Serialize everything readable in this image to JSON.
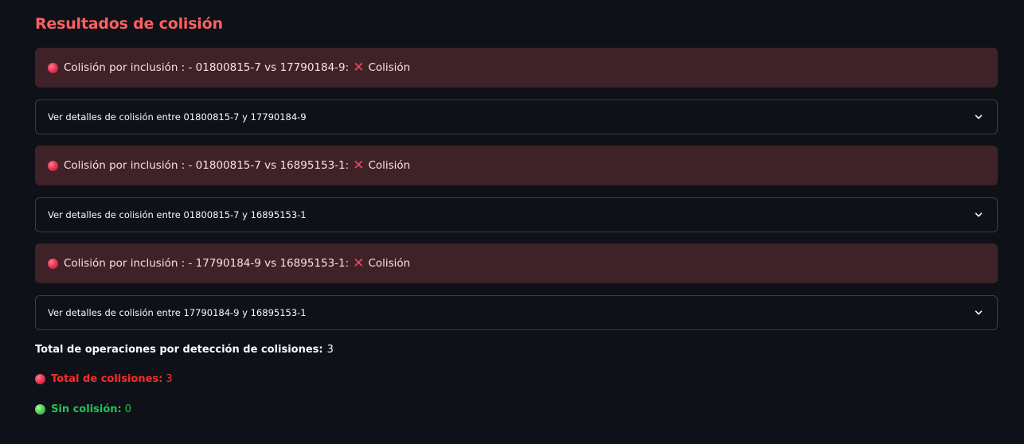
{
  "title": "Resultados de colisión",
  "results": [
    {
      "alert_text": "Colisión por inclusión : - 01800815-7 vs 17790184-9:",
      "status": "Colisión",
      "expander_label": "Ver detalles de colisión entre 01800815-7 y 17790184-9"
    },
    {
      "alert_text": "Colisión por inclusión : - 01800815-7 vs 16895153-1:",
      "status": "Colisión",
      "expander_label": "Ver detalles de colisión entre 01800815-7 y 16895153-1"
    },
    {
      "alert_text": "Colisión por inclusión : - 17790184-9 vs 16895153-1:",
      "status": "Colisión",
      "expander_label": "Ver detalles de colisión entre 17790184-9 y 16895153-1"
    }
  ],
  "summary": {
    "total_ops_label": "Total de operaciones por detección de colisiones:",
    "total_ops_value": "3",
    "total_collisions_label": "Total de colisiones:",
    "total_collisions_value": "3",
    "no_collision_label": "Sin colisión:",
    "no_collision_value": "0"
  },
  "icons": {
    "collision": "red-circle-icon",
    "status": "cross-mark-icon",
    "expander": "chevron-down-icon",
    "no_collision": "green-circle-icon"
  },
  "colors": {
    "title": "#ff6060",
    "alert_background": "#3e2227",
    "collision_text": "#ff2b2b",
    "no_collision_text": "#21c354"
  }
}
